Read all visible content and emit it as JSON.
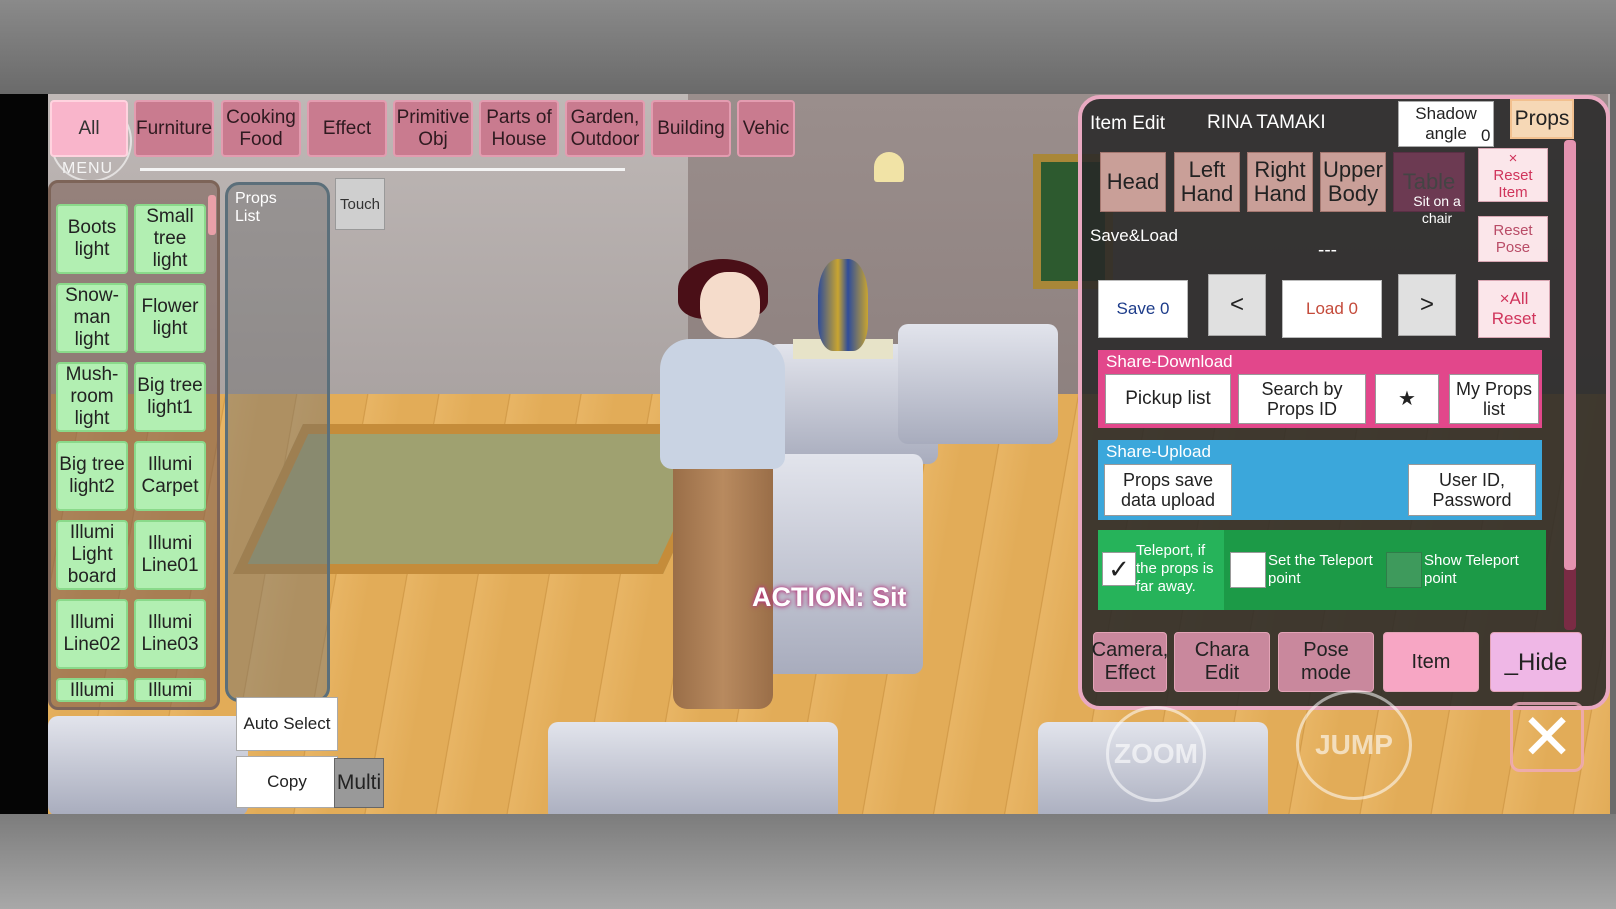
{
  "tabs": [
    {
      "label": "All",
      "active": true
    },
    {
      "label": "Furniture"
    },
    {
      "label": "Cooking Food"
    },
    {
      "label": "Effect"
    },
    {
      "label": "Primitive Obj"
    },
    {
      "label": "Parts of House"
    },
    {
      "label": "Garden, Outdoor"
    },
    {
      "label": "Building"
    },
    {
      "label": "Vehic"
    }
  ],
  "menu_label": "MENU",
  "props_items": [
    "Boots light",
    "Small tree light",
    "Snow-man light",
    "Flower light",
    "Mush-room light",
    "Big tree light1",
    "Big tree light2",
    "Illumi Carpet",
    "Illumi Light board",
    "Illumi Line01",
    "Illumi Line02",
    "Illumi Line03",
    "Illumi",
    "Illumi"
  ],
  "props_list_title": "Props List",
  "touch_label": "Touch",
  "auto_select_label": "Auto Select",
  "copy_label": "Copy",
  "multi_label": "Multi",
  "action_text": "ACTION: Sit",
  "panel": {
    "title": "Item Edit",
    "character_name": "RINA TAMAKI",
    "shadow_angle_label": "Shadow angle",
    "shadow_angle_value": "0",
    "props_tab": "Props",
    "body_tabs": [
      "Head",
      "Left Hand",
      "Right Hand",
      "Upper Body"
    ],
    "table_tab": "Table",
    "table_subtext": "Sit on a chair",
    "reset_item_x": "×",
    "reset_item": "Reset Item",
    "reset_pose": "Reset Pose",
    "save_load_label": "Save&Load",
    "slot_name": "---",
    "save_label": "Save 0",
    "prev_label": "<",
    "load_label": "Load 0",
    "next_label": ">",
    "all_reset": "×All Reset",
    "share_download": {
      "title": "Share-Download",
      "pickup": "Pickup list",
      "search": "Search by Props ID",
      "star": "★",
      "my_props": "My Props list"
    },
    "share_upload": {
      "title": "Share-Upload",
      "upload": "Props save data upload",
      "user_id": "User ID, Password"
    },
    "teleport": {
      "if_far": "Teleport, if the props is far away.",
      "set_point": "Set the Teleport point",
      "show_point": "Show Teleport point",
      "checked": true
    },
    "bottom_tabs": [
      "Camera, Effect",
      "Chara Edit",
      "Pose mode",
      "Item",
      "_Hide"
    ]
  },
  "zoom_label": "ZOOM",
  "jump_label": "JUMP",
  "close_symbol": "✕",
  "colors": {
    "tab": "#c97b8f",
    "tab_active": "#f9b5cb",
    "list_item": "#b2efb2",
    "share_download": "#e2478b",
    "share_upload": "#3ba7db",
    "teleport": "#1c9a47"
  }
}
